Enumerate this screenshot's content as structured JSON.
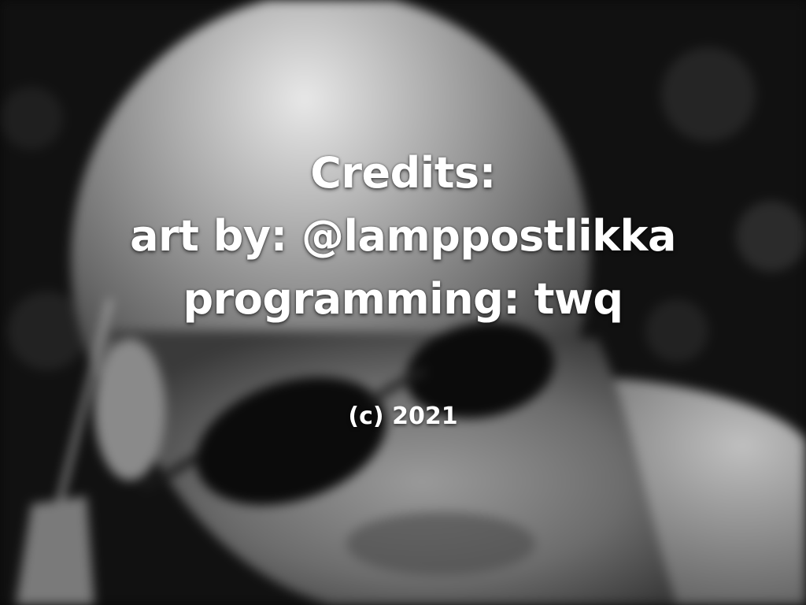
{
  "credits": {
    "heading": "Credits:",
    "art_line": "art by: @lamppostlikka",
    "programming_line": "programming: twq",
    "copyright": "(c) 2021"
  },
  "background": {
    "description_icon": "portrait-photo",
    "tone": "grayscale"
  }
}
